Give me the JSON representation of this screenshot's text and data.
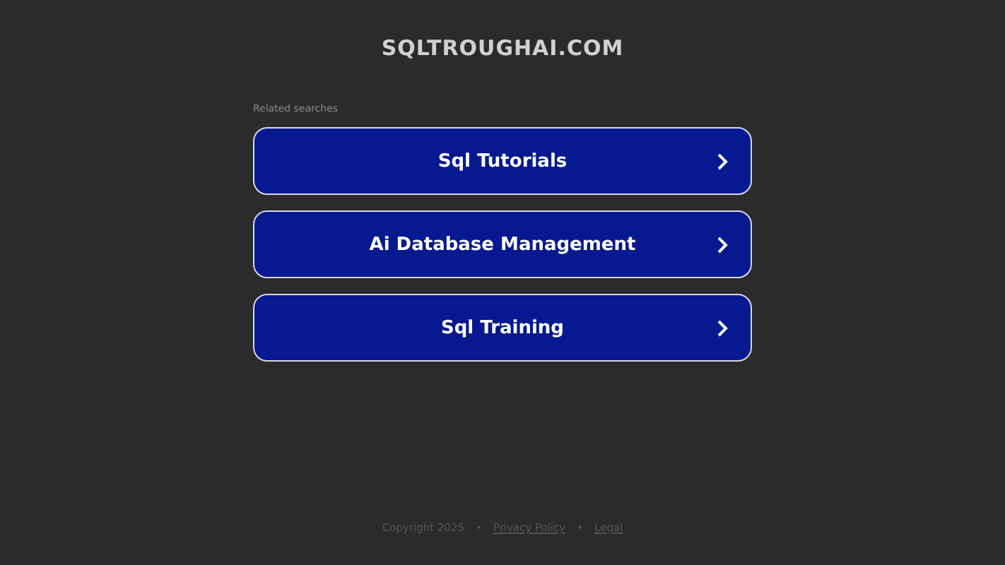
{
  "site_title": "SQLTROUGHAI.COM",
  "related_label": "Related searches",
  "links": [
    {
      "label": "Sql Tutorials"
    },
    {
      "label": "Ai Database Management"
    },
    {
      "label": "Sql Training"
    }
  ],
  "footer": {
    "copyright": "Copyright 2025",
    "separator": "•",
    "links": [
      "Privacy Policy",
      "Legal"
    ]
  }
}
